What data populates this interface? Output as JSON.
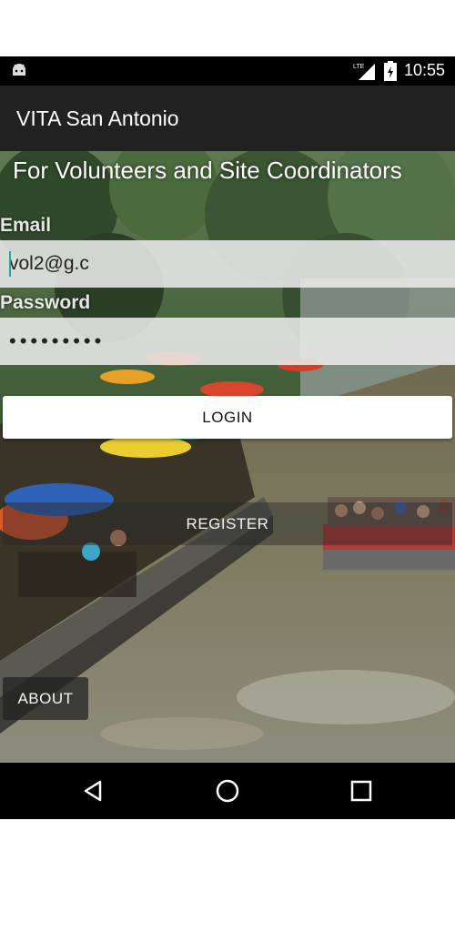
{
  "status_bar": {
    "network": "LTE",
    "time": "10:55",
    "icons": [
      "android-icon",
      "lte-signal-icon",
      "battery-icon"
    ]
  },
  "app_bar": {
    "title": "VITA San Antonio"
  },
  "main": {
    "subtitle": "For Volunteers and Site Coordinators",
    "email": {
      "label": "Email",
      "value": "vol2@g.c"
    },
    "password": {
      "label": "Password",
      "value": "•••••••••"
    },
    "login_label": "LOGIN",
    "register_label": "REGISTER",
    "about_label": "ABOUT"
  },
  "nav_bar": {
    "icons": [
      "back-icon",
      "home-icon",
      "recents-icon"
    ]
  },
  "colors": {
    "app_bar": "#212121",
    "accent_cursor": "#26a69a",
    "login_button": "#ffffff"
  }
}
